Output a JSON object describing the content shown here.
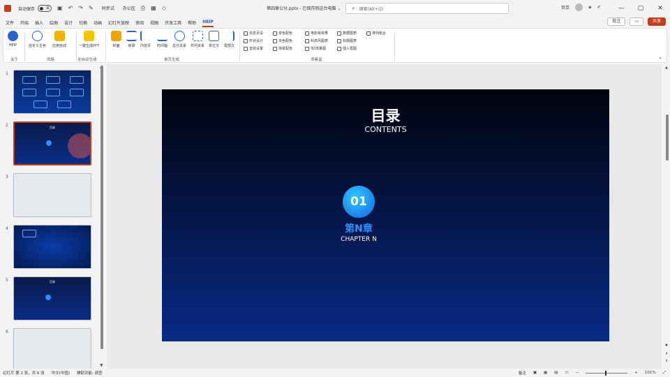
{
  "titlebar": {
    "autosave": "自动保存",
    "toggle": "关",
    "qa_text_1": "同步试",
    "qa_text_2": "办公区",
    "doc_title": "第四章公分.pptx - 已保存到这台电脑 ⌄",
    "search_placeholder": "搜索(Alt+Q)",
    "user": "世京"
  },
  "window_controls": [
    "—",
    "▢",
    "✕"
  ],
  "tabs": [
    "文件",
    "开始",
    "插入",
    "绘图",
    "设计",
    "切换",
    "动画",
    "幻灯片放映",
    "审阅",
    "视图",
    "开发工具",
    "帮助",
    "HEIP"
  ],
  "tabs_right": {
    "comment": "批注",
    "share": "共享"
  },
  "ribbon": {
    "buttons": [
      {
        "label": "HEIP"
      },
      {
        "label": "自定义主色"
      },
      {
        "label": "应用自动"
      },
      {
        "label": "一键生成PPT"
      },
      {
        "label": "封面"
      },
      {
        "label": "目录"
      },
      {
        "label": "内容页"
      },
      {
        "label": "时间轴"
      },
      {
        "label": "总分关系"
      },
      {
        "label": "并列关系"
      },
      {
        "label": "单位文"
      },
      {
        "label": "尾部文"
      }
    ],
    "groups": [
      "关于",
      "风格",
      "全自动生成",
      "单页生成",
      "添素盒"
    ],
    "checkboxes": [
      "信息页设",
      "单色配色",
      "电影级效果",
      "数据图表",
      "排列组合",
      "形状设计",
      "多色配色",
      "科技风图表",
      "标题图表",
      "音效设置",
      "渐变配色",
      "3D流量图",
      "插入框图"
    ]
  },
  "thumbnails": [
    {
      "num": "1",
      "style": "grid1"
    },
    {
      "num": "2",
      "style": "dark",
      "title": "目录",
      "selected": true
    },
    {
      "num": "3",
      "style": "light"
    },
    {
      "num": "4",
      "style": "dark"
    },
    {
      "num": "5",
      "style": "dark",
      "title": "目录"
    },
    {
      "num": "6",
      "style": "light"
    }
  ],
  "slide": {
    "title": "目录",
    "subtitle": "CONTENTS",
    "number": "01",
    "chapter": "第N章",
    "chapter_en": "CHAPTER N"
  },
  "status": {
    "slide_info": "幻灯片 第 2 张，共 6 张",
    "lang": "中文(中国)",
    "access": "辅助功能: 调查",
    "notes": "备注",
    "zoom": "101%"
  }
}
